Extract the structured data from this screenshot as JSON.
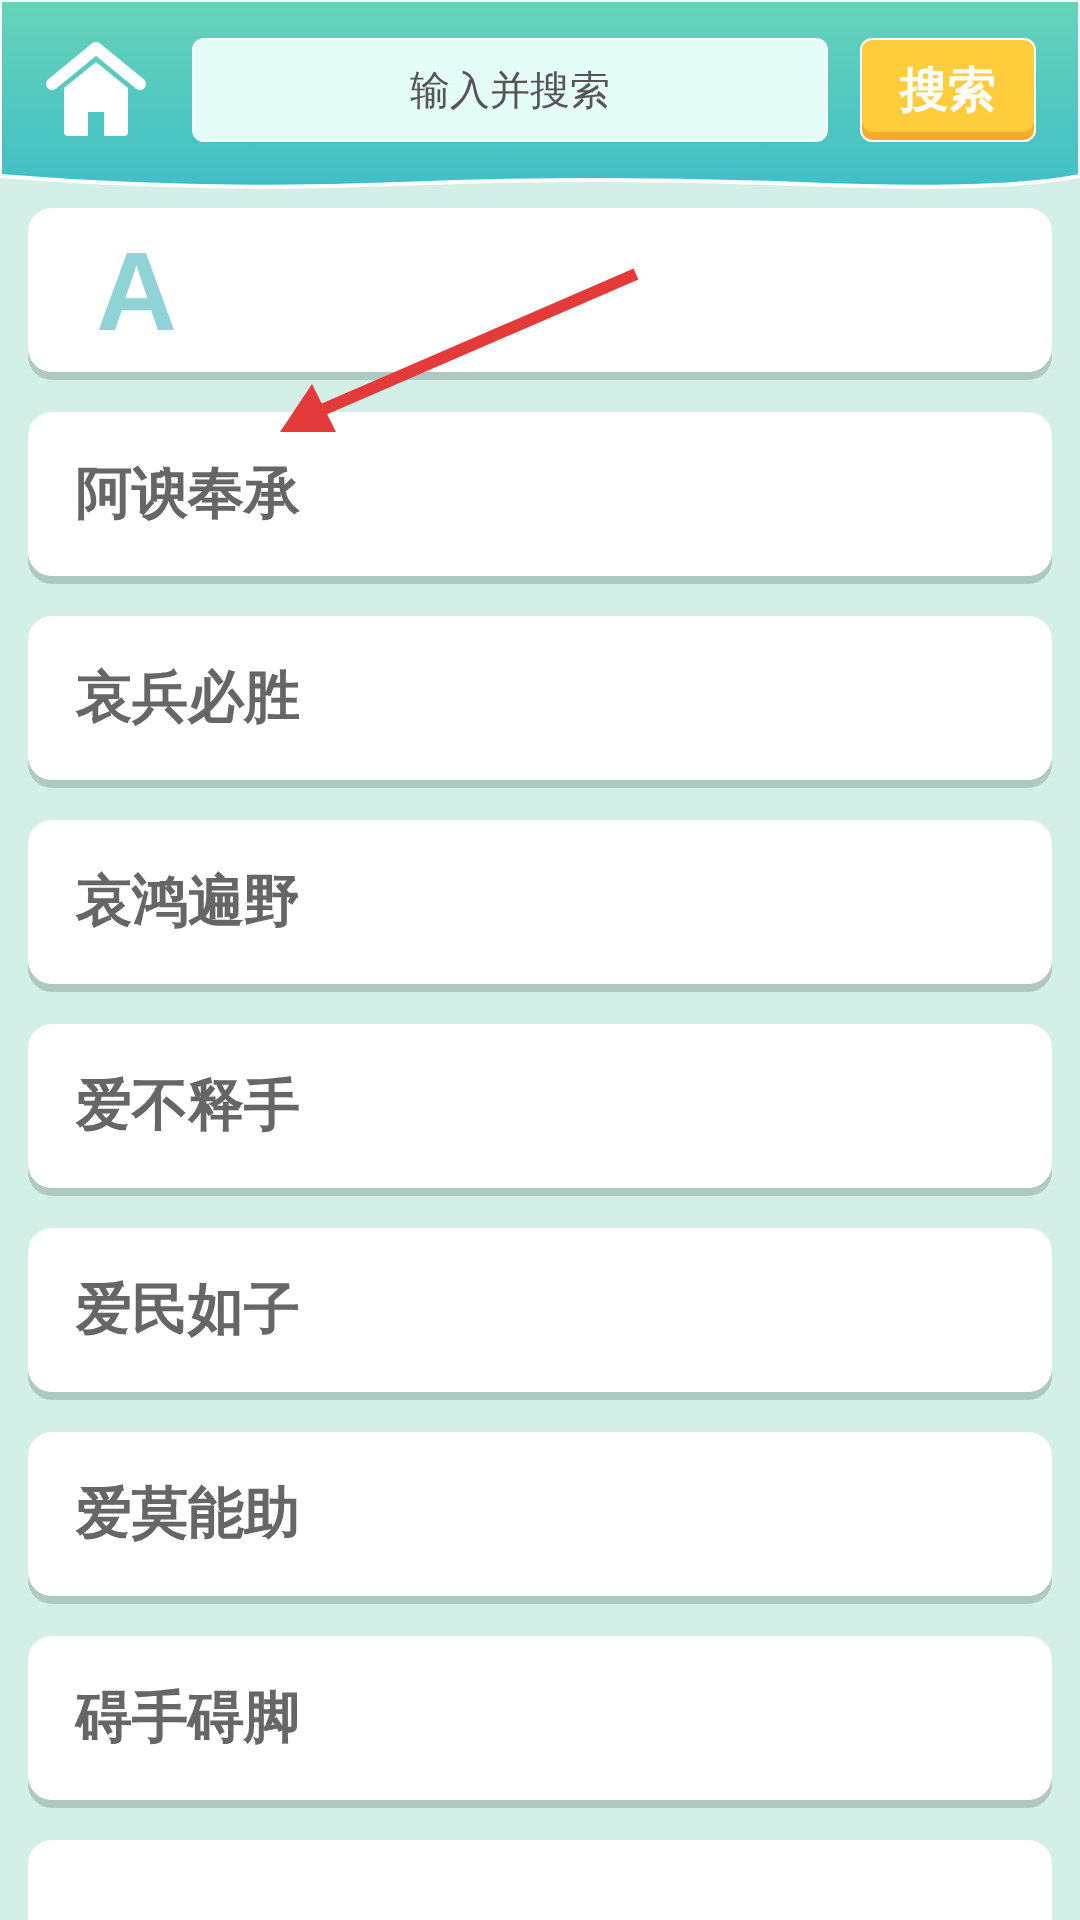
{
  "header": {
    "search": {
      "placeholder": "输入并搜索"
    },
    "search_button": "搜索"
  },
  "section": {
    "letter": "A",
    "items": [
      "阿谀奉承",
      "哀兵必胜",
      "哀鸿遍野",
      "爱不释手",
      "爱民如子",
      "爱莫能助",
      "碍手碍脚"
    ]
  }
}
